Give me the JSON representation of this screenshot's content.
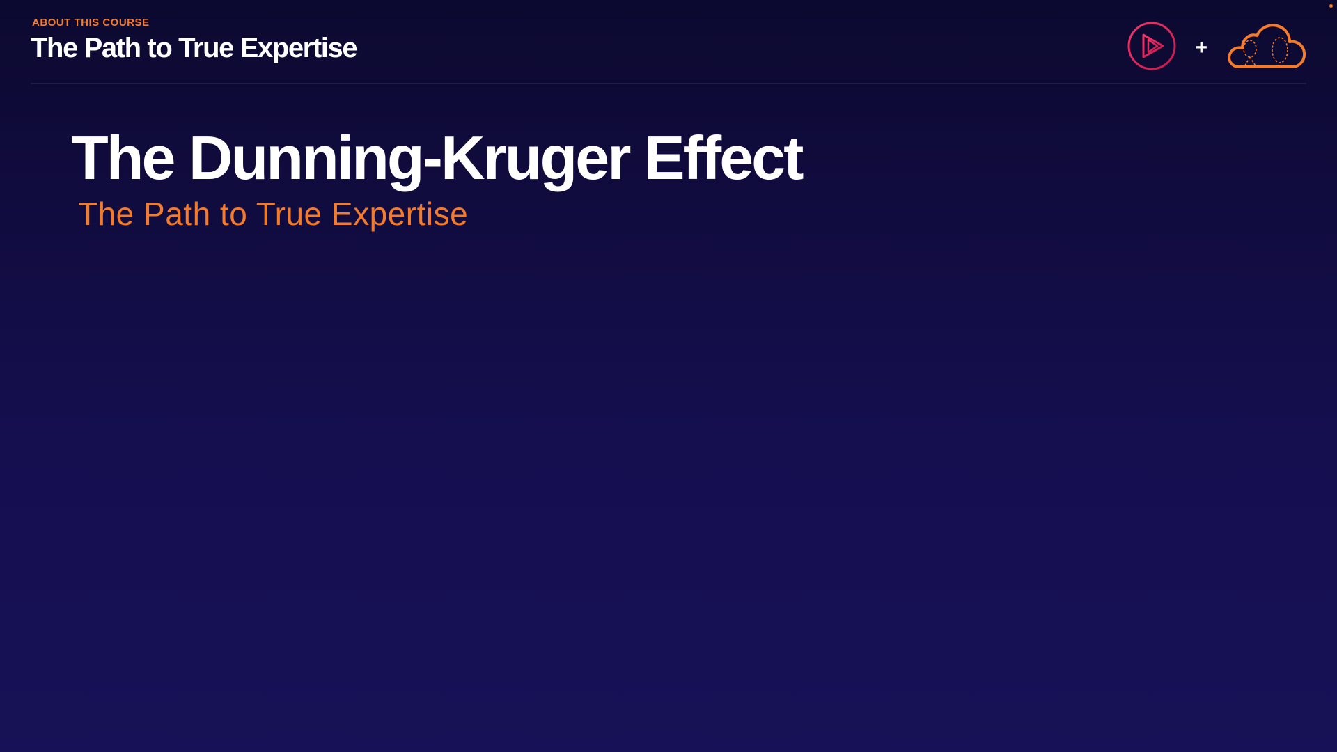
{
  "header": {
    "eyebrow": "ABOUT THIS COURSE",
    "course_title": "The Path to True Expertise"
  },
  "logos": {
    "play_logo_icon": "play-circle-icon",
    "plus_sign": "+",
    "cloud_logo_icon": "cloud-icon",
    "play_logo_color": "#e8305f",
    "cloud_logo_color": "#f47b2a"
  },
  "slide": {
    "title": "The Dunning-Kruger Effect",
    "subtitle": "The Path to True Expertise"
  },
  "colors": {
    "accent": "#f47b2a",
    "background_top": "#0c0930",
    "background_bottom": "#171157",
    "text": "#ffffff"
  }
}
